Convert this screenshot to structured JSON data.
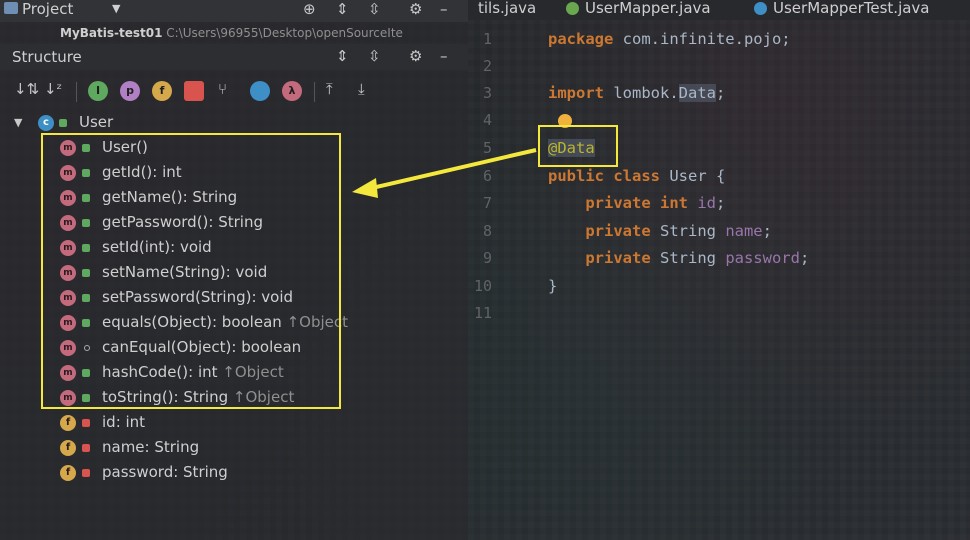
{
  "project_bar": {
    "title": "Project"
  },
  "module_row": {
    "name": "MyBatis-test01",
    "path": "C:\\Users\\96955\\Desktop\\openSourceIte"
  },
  "structure_panel": {
    "title": "Structure"
  },
  "toolbar": {
    "buttons": [
      "sort-by-visibility",
      "sort-alpha",
      "show-inherited",
      "show-properties",
      "show-fields",
      "show-non-public",
      "show-anonymous",
      "show-lambdas",
      "show-includes",
      "expand-all",
      "collapse-all"
    ],
    "labels": {
      "inherited": "I",
      "properties": "p",
      "fields": "f",
      "lambdas": "λ"
    }
  },
  "tree": {
    "root": {
      "label": "User",
      "icon": "class-icon"
    },
    "methods": [
      {
        "label": "User()",
        "inherited": ""
      },
      {
        "label": "getId(): int",
        "inherited": ""
      },
      {
        "label": "getName(): String",
        "inherited": ""
      },
      {
        "label": "getPassword(): String",
        "inherited": ""
      },
      {
        "label": "setId(int): void",
        "inherited": ""
      },
      {
        "label": "setName(String): void",
        "inherited": ""
      },
      {
        "label": "setPassword(String): void",
        "inherited": ""
      },
      {
        "label": "equals(Object): boolean",
        "inherited": "↑Object"
      },
      {
        "label": "canEqual(Object): boolean",
        "inherited": ""
      },
      {
        "label": "hashCode(): int",
        "inherited": "↑Object"
      },
      {
        "label": "toString(): String",
        "inherited": "↑Object"
      }
    ],
    "fields": [
      {
        "label": "id: int"
      },
      {
        "label": "name: String"
      },
      {
        "label": "password: String"
      }
    ]
  },
  "tabs": [
    {
      "label": "tils.java",
      "color": "#e5a84b"
    },
    {
      "label": "UserMapper.java",
      "color": "#6aa84f"
    },
    {
      "label": "UserMapperTest.java",
      "color": "#3d8fc6"
    }
  ],
  "editor": {
    "line_numbers": [
      "1",
      "2",
      "3",
      "4",
      "5",
      "6",
      "7",
      "8",
      "9",
      "10",
      "11"
    ],
    "code": {
      "l1_kw": "package",
      "l1_rest": " com.infinite.pojo;",
      "l3_kw": "import",
      "l3_pkg": " lombok.",
      "l3_cls": "Data",
      "l3_end": ";",
      "l5_ann": "@Data",
      "l6_kw1": "public",
      "l6_kw2": " class",
      "l6_rest": " User {",
      "l7_kw": "private",
      "l7_type": " int",
      "l7_field": " id",
      "l7_end": ";",
      "l8_kw": "private",
      "l8_type": " String",
      "l8_field": " name",
      "l8_end": ";",
      "l9_kw": "private",
      "l9_type": " String",
      "l9_field": " password",
      "l9_end": ";",
      "l10": "}"
    }
  },
  "colors": {
    "highlight": "#f3e83b",
    "keyword": "#cc7832",
    "field": "#9876aa",
    "annotation": "#bbb529"
  }
}
